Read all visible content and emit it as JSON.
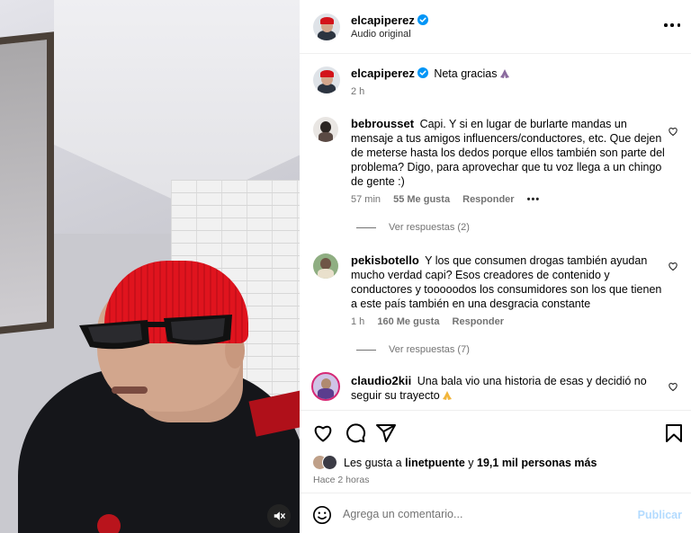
{
  "colors": {
    "accent": "#0095f6",
    "verified": "#0095f6",
    "publish_disabled": "#b3dbff",
    "muted_text": "#737373"
  },
  "header": {
    "username": "elcapiperez",
    "subtitle": "Audio original",
    "verified_icon": "verified-badge-icon",
    "more_icon": "more-options-icon"
  },
  "caption": {
    "username": "elcapiperez",
    "text": "Neta gracias",
    "emoji": "praying-hands",
    "time": "2 h"
  },
  "comments": [
    {
      "username": "bebrousset",
      "text": "Capi. Y si en lugar de burlarte mandas un mensaje a tus amigos influencers/conductores, etc. Que dejen de meterse hasta los dedos porque ellos también son parte del problema? Digo, para aprovechar que tu voz llega a un chingo de gente :)",
      "time": "57 min",
      "likes": "55 Me gusta",
      "reply": "Responder",
      "options": "•••",
      "view_replies": "Ver respuestas (2)"
    },
    {
      "username": "pekisbotello",
      "text": "Y los que consumen drogas también ayudan mucho verdad capi? Esos creadores de contenido y conductores y tooooodos los consumidores son los que tienen a este país también en una desgracia constante",
      "time": "1 h",
      "likes": "160 Me gusta",
      "reply": "Responder",
      "view_replies": "Ver respuestas (7)"
    },
    {
      "username": "claudio2kii",
      "text": "Una bala vio una historia de esas y decidió no seguir su trayecto",
      "emoji": "praying-hands"
    }
  ],
  "actions": {
    "like_icon": "heart-icon",
    "comment_icon": "comment-icon",
    "share_icon": "share-icon",
    "save_icon": "bookmark-icon"
  },
  "likes": {
    "prefix": "Les gusta a",
    "user": "linetpuente",
    "middle": "y",
    "count": "19,1 mil personas más"
  },
  "posted": "Hace 2 horas",
  "composer": {
    "placeholder": "Agrega un comentario...",
    "publish": "Publicar",
    "emoji_icon": "smiley-icon"
  },
  "media": {
    "mute_icon": "muted-speaker-icon"
  }
}
